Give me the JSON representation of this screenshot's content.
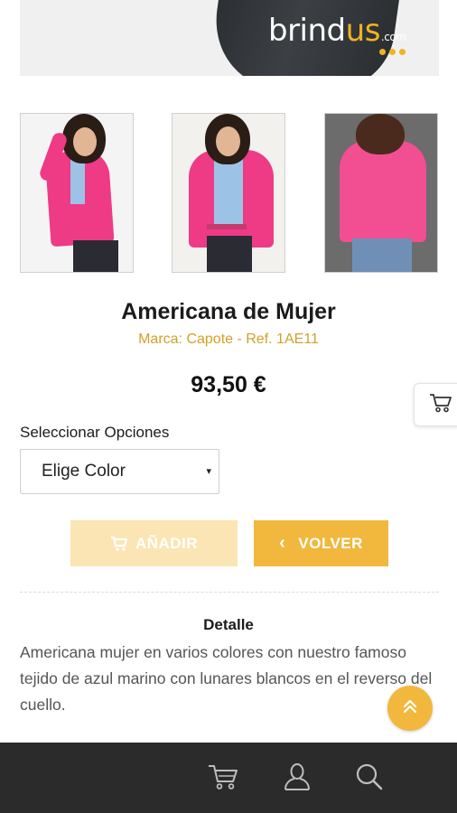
{
  "hero": {
    "logo_main": "brind",
    "logo_accent": "us",
    "logo_suffix": ".com"
  },
  "product": {
    "title": "Americana de Mujer",
    "brand_ref": "Marca: Capote - Ref. 1AE11",
    "price": "93,50 €",
    "images": [
      {
        "name": "front-pose-hair"
      },
      {
        "name": "front-pose-open"
      },
      {
        "name": "back-pose"
      }
    ]
  },
  "options": {
    "label": "Seleccionar Opciones",
    "select_value": "Elige Color",
    "arrow": "▾"
  },
  "buttons": {
    "add_label": "AÑADIR",
    "back_label": "VOLVER",
    "back_chevron": "‹"
  },
  "detail": {
    "title": "Detalle",
    "text": "Americana mujer en varios colores con nuestro famoso tejido de azul marino con lunares blancos en el reverso del cuello."
  },
  "icons": {
    "floating_cart": "cart-icon",
    "scroll_top": "double-chevron-up-icon",
    "nav": [
      "cart-icon",
      "user-icon",
      "search-icon"
    ]
  },
  "colors": {
    "accent": "#f1b83d",
    "accent_light": "#fbe5b4",
    "brand_text": "#d2a128",
    "jacket_pink": "#ef3a86",
    "bottom_bar": "#2b2b2b"
  }
}
